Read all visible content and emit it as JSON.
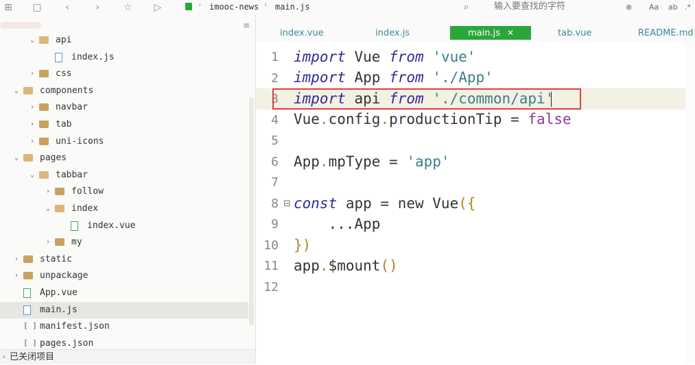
{
  "breadcrumb": {
    "project": "imooc-news",
    "file": "main.js"
  },
  "search": {
    "placeholder": "输入要查找的字符"
  },
  "toolbar_right": {
    "aa": "Aa"
  },
  "tabs": [
    {
      "label": "index.vue",
      "active": false
    },
    {
      "label": "index.js",
      "active": false
    },
    {
      "label": "main.js",
      "active": true,
      "close": "✕"
    },
    {
      "label": "tab.vue",
      "active": false
    },
    {
      "label": "README.md",
      "active": false
    }
  ],
  "tree": [
    {
      "label": "api",
      "kind": "folder",
      "open": true
    },
    {
      "label": "index.js",
      "kind": "js"
    },
    {
      "label": "css",
      "kind": "folder",
      "open": false
    },
    {
      "label": "components",
      "kind": "folder",
      "open": true
    },
    {
      "label": "navbar",
      "kind": "folder",
      "open": false
    },
    {
      "label": "tab",
      "kind": "folder",
      "open": false
    },
    {
      "label": "uni-icons",
      "kind": "folder",
      "open": false
    },
    {
      "label": "pages",
      "kind": "folder",
      "open": true
    },
    {
      "label": "tabbar",
      "kind": "folder",
      "open": true
    },
    {
      "label": "follow",
      "kind": "folder",
      "open": false
    },
    {
      "label": "index",
      "kind": "folder",
      "open": true
    },
    {
      "label": "index.vue",
      "kind": "vue"
    },
    {
      "label": "my",
      "kind": "folder",
      "open": false
    },
    {
      "label": "static",
      "kind": "folder",
      "open": false
    },
    {
      "label": "unpackage",
      "kind": "folder",
      "open": false
    },
    {
      "label": "App.vue",
      "kind": "vue"
    },
    {
      "label": "main.js",
      "kind": "js",
      "selected": true
    },
    {
      "label": "manifest.json",
      "kind": "json"
    },
    {
      "label": "pages.json",
      "kind": "json"
    }
  ],
  "closed_projects": "已关闭项目",
  "code": {
    "line_numbers": [
      "1",
      "2",
      "3",
      "4",
      "5",
      "6",
      "7",
      "8",
      "9",
      "10",
      "11",
      "12"
    ],
    "l1": {
      "kw1": "import",
      "id": " Vue ",
      "kw2": "from",
      "sp": " ",
      "str": "'vue'"
    },
    "l2": {
      "kw1": "import",
      "id": " App ",
      "kw2": "from",
      "sp": " ",
      "str": "'./App'"
    },
    "l3": {
      "kw1": "import",
      "id": " api ",
      "kw2": "from",
      "sp": " ",
      "str": "'./common/api'"
    },
    "l4": {
      "a": "Vue",
      "dot1": ".",
      "b": "config",
      "dot2": ".",
      "c": "productionTip = ",
      "lit": "false"
    },
    "l6": {
      "a": "App",
      "dot": ".",
      "b": "mpType = ",
      "str": "'app'"
    },
    "l8": {
      "kw": "const",
      "b": " app = new Vue",
      "pn": "({"
    },
    "l9": {
      "text": "    ...App"
    },
    "l10": {
      "pn": "})"
    },
    "l11": {
      "a": "app",
      "dot": ".",
      "b": "$mount",
      "pn": "()"
    }
  }
}
